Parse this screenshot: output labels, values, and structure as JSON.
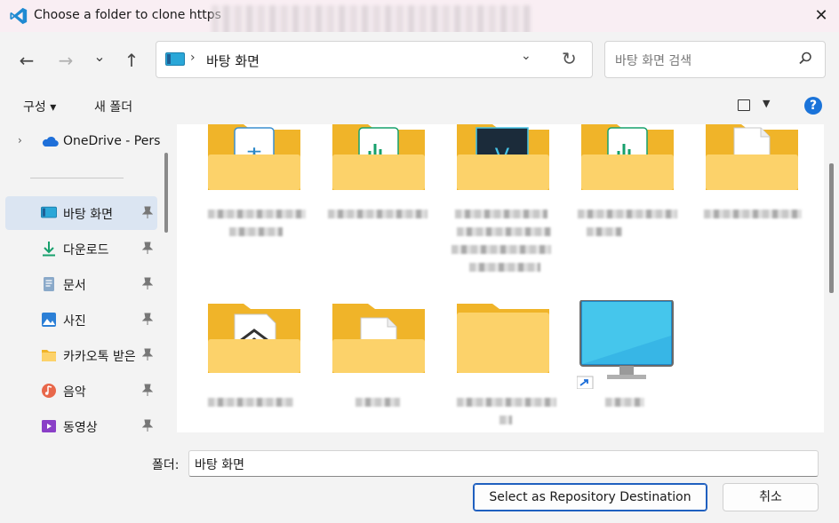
{
  "window": {
    "title": "Choose a folder to clone https",
    "close_glyph": "✕"
  },
  "nav": {
    "back_glyph": "←",
    "forward_glyph": "→",
    "recent_glyph": "⌄",
    "up_glyph": "↑"
  },
  "address": {
    "location_icon": "desktop-icon",
    "separator": "›",
    "path": "바탕 화면",
    "dropdown_glyph": "⌄",
    "refresh_glyph": "↻"
  },
  "search": {
    "placeholder": "바탕 화면 검색"
  },
  "toolbar": {
    "organize_label": "구성 ▾",
    "new_folder_label": "새 폴더",
    "view_dropdown_glyph": "▼",
    "help_glyph": "?"
  },
  "sidebar": {
    "items": [
      {
        "label": "OneDrive - Pers",
        "icon": "cloud-icon",
        "color": "#1e6fd9"
      },
      {
        "label": "바탕 화면",
        "icon": "desktop-icon",
        "pinned": true,
        "selected": true
      },
      {
        "label": "다운로드",
        "icon": "download-icon",
        "pinned": true
      },
      {
        "label": "문서",
        "icon": "document-icon",
        "pinned": true
      },
      {
        "label": "사진",
        "icon": "pictures-icon",
        "pinned": true
      },
      {
        "label": "카카오톡 받은",
        "icon": "folder-icon",
        "pinned": true
      },
      {
        "label": "음악",
        "icon": "music-icon",
        "pinned": true
      },
      {
        "label": "동영상",
        "icon": "video-icon",
        "pinned": true
      }
    ]
  },
  "bottom": {
    "folder_label": "폴더:",
    "folder_value": "바탕 화면",
    "select_button": "Select as Repository Destination",
    "cancel_button": "취소"
  },
  "colors": {
    "accent": "#1a73d9",
    "folder_back": "#f0b429",
    "folder_front": "#fcd26a",
    "selected_bg": "#dbe5f2"
  }
}
